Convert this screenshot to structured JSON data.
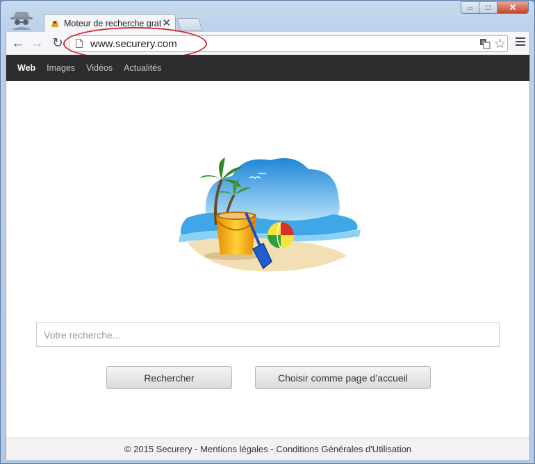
{
  "browser": {
    "tab_title": "Moteur de recherche gratuit",
    "tab_close": "✕",
    "url": "www.securery.com",
    "window_controls": {
      "minimize": "▭",
      "maximize": "□",
      "close": "✕"
    }
  },
  "nav": {
    "items": [
      {
        "label": "Web",
        "active": true
      },
      {
        "label": "Images",
        "active": false
      },
      {
        "label": "Vidéos",
        "active": false
      },
      {
        "label": "Actualités",
        "active": false
      }
    ]
  },
  "search": {
    "placeholder": "Votre recherche...",
    "value": ""
  },
  "buttons": {
    "search_label": "Rechercher",
    "homepage_label": "Choisir comme page d’accueil"
  },
  "footer": {
    "text": "© 2015 Securery - Mentions légales - Conditions Générales d'Utilisation"
  },
  "colors": {
    "nav_bar": "#2d2d2d",
    "highlight": "#d6262b",
    "window_frame": "#bcd0ea"
  }
}
